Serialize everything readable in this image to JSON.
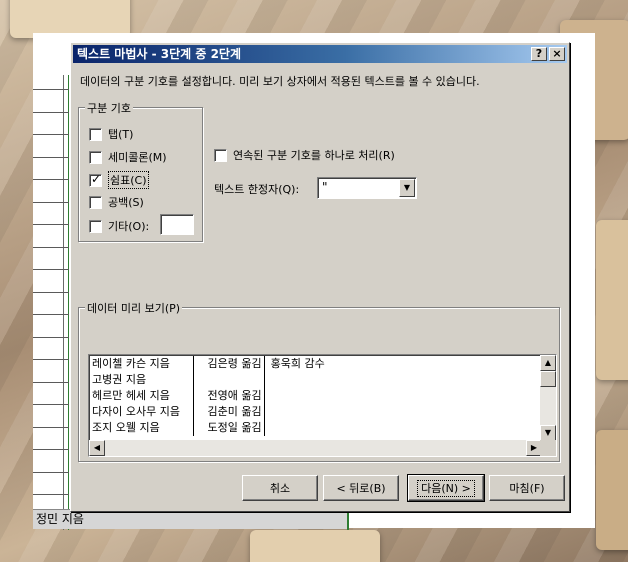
{
  "dialog": {
    "title": "텍스트 마법사 - 3단계 중 2단계",
    "help_label": "?",
    "close_label": "×",
    "description": "데이터의 구분 기호를 설정합니다. 미리 보기 상자에서 적용된 텍스트를 볼 수 있습니다."
  },
  "delimiters": {
    "group_label": "구분 기호",
    "items": [
      {
        "label": "탭(T)",
        "checked": false
      },
      {
        "label": "세미콜론(M)",
        "checked": false
      },
      {
        "label": "쉼표(C)",
        "checked": true
      },
      {
        "label": "공백(S)",
        "checked": false
      },
      {
        "label": "기타(O):",
        "checked": false
      }
    ],
    "other_value": ""
  },
  "options": {
    "consecutive_label": "연속된 구분 기호를 하나로 처리(R)",
    "consecutive_checked": false,
    "qualifier_label": "텍스트 한정자(Q):",
    "qualifier_value": "\""
  },
  "preview": {
    "group_label": "데이터 미리 보기(P)",
    "rows": [
      [
        "레이첼 카슨 지음",
        "김은령 옮김",
        "홍욱희 감수"
      ],
      [
        "고병권 지음",
        "",
        ""
      ],
      [
        "헤르만 헤세 지음",
        "전영애 옮김",
        ""
      ],
      [
        "다자이 오사무 지음",
        "김춘미 옮김",
        ""
      ],
      [
        "조지 오웰 지음",
        "도정일 옮김",
        ""
      ]
    ]
  },
  "buttons": {
    "cancel": "취소",
    "back": "< 뒤로(B)",
    "next": "다음(N) >",
    "finish": "마침(F)"
  },
  "sheet": {
    "cell_text": "정민 지음"
  }
}
